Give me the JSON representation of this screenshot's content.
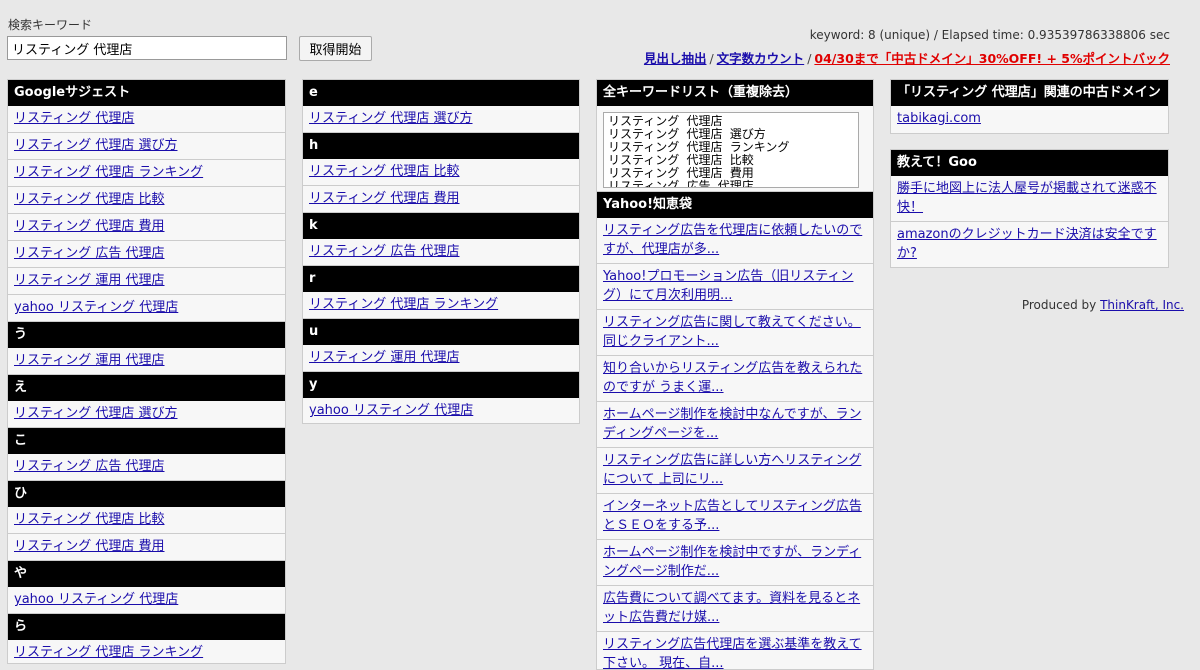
{
  "search": {
    "label": "検索キーワード",
    "value": "リスティング 代理店",
    "button": "取得開始"
  },
  "stats": "keyword: 8 (unique) / Elapsed time: 0.93539786338806 sec",
  "toplinks": {
    "heading": "見出し抽出",
    "charcount": "文字数カウント",
    "sale": "04/30まで「中古ドメイン」30%OFF! + 5%ポイントバック"
  },
  "google": {
    "title": "Googleサジェスト",
    "items": [
      "リスティング 代理店",
      "リスティング 代理店 選び方",
      "リスティング 代理店 ランキング",
      "リスティング 代理店 比較",
      "リスティング 代理店 費用",
      "リスティング 広告 代理店",
      "リスティング 運用 代理店",
      "yahoo リスティング 代理店"
    ],
    "groups": [
      {
        "letter": "う",
        "items": [
          "リスティング 運用 代理店"
        ]
      },
      {
        "letter": "え",
        "items": [
          "リスティング 代理店 選び方"
        ]
      },
      {
        "letter": "こ",
        "items": [
          "リスティング 広告 代理店"
        ]
      },
      {
        "letter": "ひ",
        "items": [
          "リスティング 代理店 比較",
          "リスティング 代理店 費用"
        ]
      },
      {
        "letter": "や",
        "items": [
          "yahoo リスティング 代理店"
        ]
      },
      {
        "letter": "ら",
        "items": [
          "リスティング 代理店 ランキング"
        ]
      }
    ]
  },
  "alpha": {
    "groups": [
      {
        "letter": "e",
        "items": [
          "リスティング 代理店 選び方"
        ]
      },
      {
        "letter": "h",
        "items": [
          "リスティング 代理店 比較",
          "リスティング 代理店 費用"
        ]
      },
      {
        "letter": "k",
        "items": [
          "リスティング 広告 代理店"
        ]
      },
      {
        "letter": "r",
        "items": [
          "リスティング 代理店 ランキング"
        ]
      },
      {
        "letter": "u",
        "items": [
          "リスティング 運用 代理店"
        ]
      },
      {
        "letter": "y",
        "items": [
          "yahoo リスティング 代理店"
        ]
      }
    ]
  },
  "allkw": {
    "title": "全キーワードリスト（重複除去）",
    "text": "リスティング 代理店\nリスティング 代理店 選び方\nリスティング 代理店 ランキング\nリスティング 代理店 比較\nリスティング 代理店 費用\nリスティング 広告 代理店\nリスティング 運用 代理店\nyahoo リスティング 代理店"
  },
  "yahoo": {
    "title": "Yahoo!知恵袋",
    "items": [
      "リスティング広告を代理店に依頼したいのですが、代理店が多...",
      "Yahoo!プロモーション広告（旧リスティング）にて月次利用明...",
      "リスティング広告に関して教えてください。同じクライアント...",
      "知り合いからリスティング広告を教えられたのですが うまく運...",
      "ホームページ制作を検討中なんですが、ランディングページを...",
      "リスティング広告に詳しい方へリスティングについて 上司にリ...",
      "インターネット広告としてリスティング広告とＳＥＯをする予...",
      "ホームページ制作を検討中ですが、ランディングページ制作だ...",
      "広告費について調べてます。資料を見るとネット広告費だけ媒...",
      "リスティング広告代理店を選ぶ基準を教えて下さい。 現在、自..."
    ]
  },
  "domain": {
    "title": "「リスティング 代理店」関連の中古ドメイン",
    "items": [
      "tabikagi.com"
    ]
  },
  "goo": {
    "title": "教えて！Goo",
    "items": [
      "勝手に地図上に法人屋号が掲載されて迷惑不快！",
      "amazonのクレジットカード決済は安全ですか?"
    ]
  },
  "produced": {
    "prefix": "Produced by ",
    "link": "ThinKraft, Inc."
  }
}
